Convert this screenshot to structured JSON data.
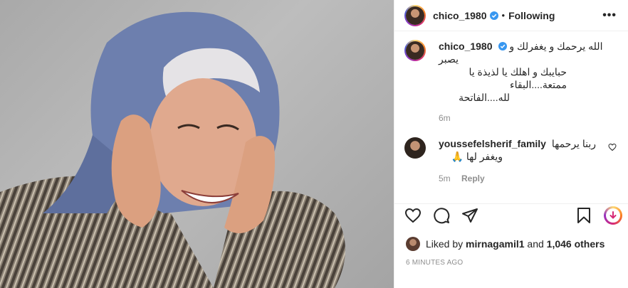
{
  "post": {
    "author": "chico_1980",
    "follow_separator": "•",
    "follow_status": "Following",
    "more_label": "•••"
  },
  "caption": {
    "username": "chico_1980",
    "lines": [
      "الله يرحمك و يغفرلك و يصبر",
      "حبايبك و اهلك يا لذيذة يا ممتعة....البقاء",
      "لله....الفاتحة"
    ],
    "time": "6m"
  },
  "comment": {
    "username": "youssefelsherif_family",
    "text_line1": "ربنا يرحمها",
    "text_line2": "ويغفر لها 🙏",
    "time": "5m",
    "reply_label": "Reply"
  },
  "likes": {
    "prefix": "Liked by",
    "first_user": "mirnagamil1",
    "conjunction": "and",
    "others": "1,046 others"
  },
  "timestamp": "6 MINUTES AGO",
  "icons": [
    "heart-icon",
    "comment-icon",
    "share-icon",
    "save-icon",
    "verified-badge-icon",
    "boost-icon"
  ],
  "colors": {
    "verified": "#3897f0",
    "muted": "#8e8e8e",
    "text": "#262626",
    "hijab": "#6d7fae"
  }
}
